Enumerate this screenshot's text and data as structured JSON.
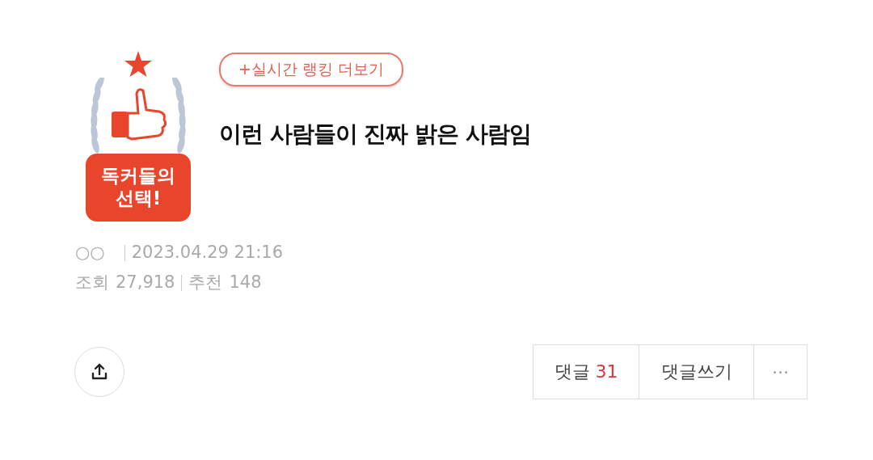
{
  "badge": {
    "label": "독커들의 선택!"
  },
  "ranking_link": "+실시간 랭킹 더보기",
  "title": "이런 사람들이 진짜 밝은 사람임",
  "meta": {
    "author": "○○",
    "date": "2023.04.29 21:16",
    "views_label": "조회",
    "views": "27,918",
    "recommend_label": "추천",
    "recommend": "148"
  },
  "actions": {
    "comments_label": "댓글",
    "comments_count": "31",
    "write": "댓글쓰기",
    "more": "···"
  }
}
